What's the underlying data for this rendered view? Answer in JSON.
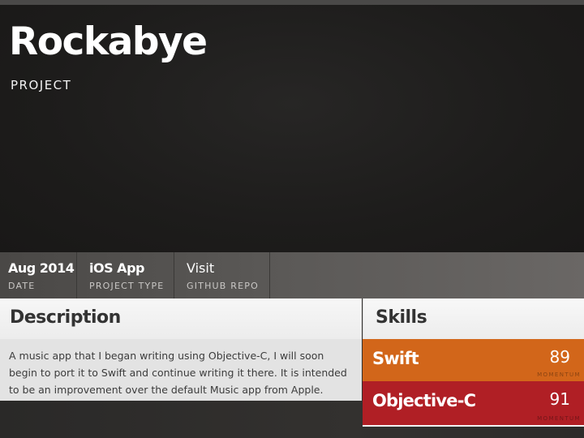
{
  "header": {
    "title": "Rockabye",
    "subtitle": "PROJECT"
  },
  "meta": [
    {
      "value": "Aug 2014",
      "label": "DATE"
    },
    {
      "value": "iOS App",
      "label": "PROJECT TYPE"
    },
    {
      "value": "Visit",
      "label": "GITHUB REPO"
    }
  ],
  "description": {
    "title": "Description",
    "body": "A music app that I began writing using Objective-C, I will soon begin to port it to Swift and continue writing it there. It is intended to be an improvement over the default Music app from Apple."
  },
  "skills": {
    "title": "Skills",
    "items": [
      {
        "name": "Swift",
        "score": "89",
        "label": "MOMENTUM",
        "color": "#d2661a"
      },
      {
        "name": "Objective-C",
        "score": "91",
        "label": "MOMENTUM",
        "color": "#b01f25"
      }
    ]
  },
  "colors": {
    "background": "#1c1b1a",
    "swift_accent": "#d2661a",
    "objc_accent": "#b01f25"
  }
}
